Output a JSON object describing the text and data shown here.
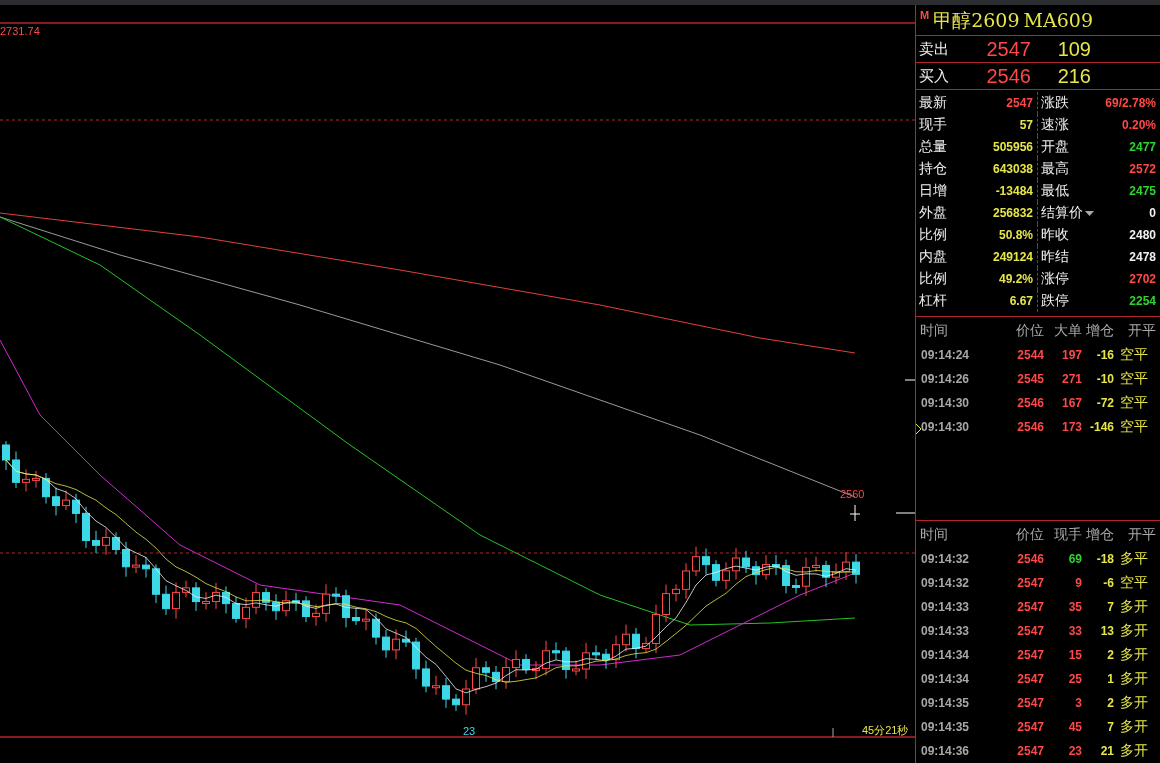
{
  "chart": {
    "top_label": "2731.74",
    "price_marker": "2560",
    "low_label": "23",
    "countdown": "45分21秒"
  },
  "quote": {
    "badge": "M",
    "title": "甲醇2609",
    "code": "MA609",
    "ask": {
      "label": "卖出",
      "price": "2547",
      "volume": "109"
    },
    "bid": {
      "label": "买入",
      "price": "2546",
      "volume": "216"
    },
    "stats": [
      {
        "label": "最新",
        "value": "2547",
        "kind": "up"
      },
      {
        "label": "涨跌",
        "value": "69/2.78%",
        "kind": "up"
      },
      {
        "label": "现手",
        "value": "57",
        "kind": "plain"
      },
      {
        "label": "速涨",
        "value": "0.20%",
        "kind": "up"
      },
      {
        "label": "总量",
        "value": "505956",
        "kind": "plain"
      },
      {
        "label": "开盘",
        "value": "2477",
        "kind": "down"
      },
      {
        "label": "持仓",
        "value": "643038",
        "kind": "plain"
      },
      {
        "label": "最高",
        "value": "2572",
        "kind": "up"
      },
      {
        "label": "日增",
        "value": "-13484",
        "kind": "plain"
      },
      {
        "label": "最低",
        "value": "2475",
        "kind": "down"
      },
      {
        "label": "外盘",
        "value": "256832",
        "kind": "plain"
      },
      {
        "label": "结算价",
        "value": "0",
        "kind": "flat",
        "dropdown": true
      },
      {
        "label": "比例",
        "value": "50.8%",
        "kind": "plain"
      },
      {
        "label": "昨收",
        "value": "2480",
        "kind": "flat"
      },
      {
        "label": "内盘",
        "value": "249124",
        "kind": "plain"
      },
      {
        "label": "昨结",
        "value": "2478",
        "kind": "flat"
      },
      {
        "label": "比例",
        "value": "49.2%",
        "kind": "plain"
      },
      {
        "label": "涨停",
        "value": "2702",
        "kind": "up"
      },
      {
        "label": "杠杆",
        "value": "6.67",
        "kind": "plain"
      },
      {
        "label": "跌停",
        "value": "2254",
        "kind": "down"
      }
    ]
  },
  "big_orders": {
    "columns": [
      "时间",
      "价位",
      "大单",
      "增仓",
      "开平"
    ],
    "rows": [
      {
        "time": "09:14:24",
        "price": "2544",
        "qty": "197",
        "change": "-16",
        "type": "空平",
        "kind": "up",
        "selected": false
      },
      {
        "time": "09:14:26",
        "price": "2545",
        "qty": "271",
        "change": "-10",
        "type": "空平",
        "kind": "up",
        "selected": false
      },
      {
        "time": "09:14:30",
        "price": "2546",
        "qty": "167",
        "change": "-72",
        "type": "空平",
        "kind": "up",
        "selected": false
      },
      {
        "time": "09:14:30",
        "price": "2546",
        "qty": "173",
        "change": "-146",
        "type": "空平",
        "kind": "up",
        "selected": true
      }
    ]
  },
  "ticks": {
    "columns": [
      "时间",
      "价位",
      "现手",
      "增仓",
      "开平"
    ],
    "rows": [
      {
        "time": "09:14:32",
        "price": "2546",
        "qty": "69",
        "change": "-18",
        "type": "多平",
        "kind": "down"
      },
      {
        "time": "09:14:32",
        "price": "2547",
        "qty": "9",
        "change": "-6",
        "type": "空平",
        "kind": "up"
      },
      {
        "time": "09:14:33",
        "price": "2547",
        "qty": "35",
        "change": "7",
        "type": "多开",
        "kind": "up"
      },
      {
        "time": "09:14:33",
        "price": "2547",
        "qty": "33",
        "change": "13",
        "type": "多开",
        "kind": "up"
      },
      {
        "time": "09:14:34",
        "price": "2547",
        "qty": "15",
        "change": "2",
        "type": "多开",
        "kind": "up"
      },
      {
        "time": "09:14:34",
        "price": "2547",
        "qty": "25",
        "change": "1",
        "type": "多开",
        "kind": "up"
      },
      {
        "time": "09:14:35",
        "price": "2547",
        "qty": "3",
        "change": "2",
        "type": "多开",
        "kind": "up"
      },
      {
        "time": "09:14:35",
        "price": "2547",
        "qty": "45",
        "change": "7",
        "type": "多开",
        "kind": "up"
      },
      {
        "time": "09:14:36",
        "price": "2547",
        "qty": "23",
        "change": "21",
        "type": "多开",
        "kind": "up"
      }
    ]
  }
}
